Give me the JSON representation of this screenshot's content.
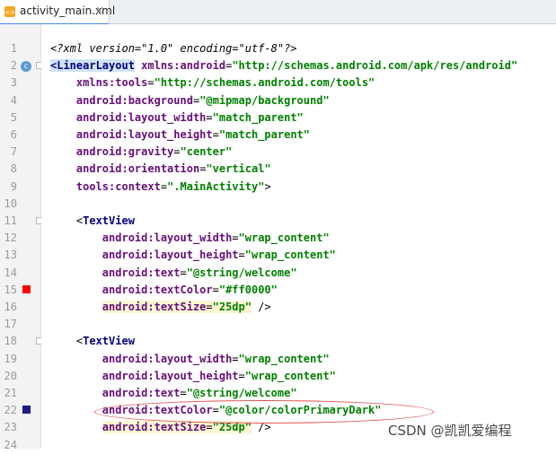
{
  "tab": {
    "filename": "activity_main.xml",
    "close": "×"
  },
  "colors": {
    "red_swatch": "#ff0000",
    "dark_swatch": "#1a1a8c",
    "circle_badge": "#5b9bd5"
  },
  "lines": [
    {
      "num": "1",
      "segs": [
        [
          "decl",
          "<?xml version=\"1.0\" encoding=\"utf-8\"?>"
        ]
      ]
    },
    {
      "num": "2",
      "segs": [
        [
          "hl-tag",
          "<LinearLayout"
        ],
        [
          "plain",
          " "
        ],
        [
          "attr",
          "xmlns:android"
        ],
        [
          "plain",
          "="
        ],
        [
          "val",
          "\"http://schemas.android.com/apk/res/android\""
        ]
      ]
    },
    {
      "num": "3",
      "segs": [
        [
          "plain",
          "    "
        ],
        [
          "attr",
          "xmlns:tools"
        ],
        [
          "plain",
          "="
        ],
        [
          "val",
          "\"http://schemas.android.com/tools\""
        ]
      ]
    },
    {
      "num": "4",
      "segs": [
        [
          "plain",
          "    "
        ],
        [
          "attr",
          "android:background"
        ],
        [
          "plain",
          "="
        ],
        [
          "val",
          "\"@mipmap/background\""
        ]
      ]
    },
    {
      "num": "5",
      "segs": [
        [
          "plain",
          "    "
        ],
        [
          "attr",
          "android:layout_width"
        ],
        [
          "plain",
          "="
        ],
        [
          "val",
          "\"match_parent\""
        ]
      ]
    },
    {
      "num": "6",
      "segs": [
        [
          "plain",
          "    "
        ],
        [
          "attr",
          "android:layout_height"
        ],
        [
          "plain",
          "="
        ],
        [
          "val",
          "\"match_parent\""
        ]
      ]
    },
    {
      "num": "7",
      "segs": [
        [
          "plain",
          "    "
        ],
        [
          "attr",
          "android:gravity"
        ],
        [
          "plain",
          "="
        ],
        [
          "val",
          "\"center\""
        ]
      ]
    },
    {
      "num": "8",
      "segs": [
        [
          "plain",
          "    "
        ],
        [
          "attr",
          "android:orientation"
        ],
        [
          "plain",
          "="
        ],
        [
          "val",
          "\"vertical\""
        ]
      ]
    },
    {
      "num": "9",
      "segs": [
        [
          "plain",
          "    "
        ],
        [
          "attr",
          "tools:context"
        ],
        [
          "plain",
          "="
        ],
        [
          "val",
          "\".MainActivity\""
        ],
        [
          "plain",
          ">"
        ]
      ]
    },
    {
      "num": "10",
      "segs": []
    },
    {
      "num": "11",
      "segs": [
        [
          "plain",
          "    <"
        ],
        [
          "tag",
          "TextView"
        ]
      ]
    },
    {
      "num": "12",
      "segs": [
        [
          "plain",
          "        "
        ],
        [
          "attr",
          "android:layout_width"
        ],
        [
          "plain",
          "="
        ],
        [
          "val",
          "\"wrap_content\""
        ]
      ]
    },
    {
      "num": "13",
      "segs": [
        [
          "plain",
          "        "
        ],
        [
          "attr",
          "android:layout_height"
        ],
        [
          "plain",
          "="
        ],
        [
          "val",
          "\"wrap_content\""
        ]
      ]
    },
    {
      "num": "14",
      "segs": [
        [
          "plain",
          "        "
        ],
        [
          "attr",
          "android:text"
        ],
        [
          "plain",
          "="
        ],
        [
          "val",
          "\"@string/welcome\""
        ]
      ]
    },
    {
      "num": "15",
      "segs": [
        [
          "plain",
          "        "
        ],
        [
          "attr",
          "android:textColor"
        ],
        [
          "plain",
          "="
        ],
        [
          "val",
          "\"#ff0000\""
        ]
      ]
    },
    {
      "num": "16",
      "segs": [
        [
          "plain",
          "        "
        ],
        [
          "attr hl-line",
          "android:textSize"
        ],
        [
          "plain hl-line",
          "="
        ],
        [
          "val hl-line",
          "\"25dp\""
        ],
        [
          "plain",
          " />"
        ]
      ]
    },
    {
      "num": "17",
      "segs": []
    },
    {
      "num": "18",
      "segs": [
        [
          "plain",
          "    <"
        ],
        [
          "tag",
          "TextView"
        ]
      ]
    },
    {
      "num": "19",
      "segs": [
        [
          "plain",
          "        "
        ],
        [
          "attr",
          "android:layout_width"
        ],
        [
          "plain",
          "="
        ],
        [
          "val",
          "\"wrap_content\""
        ]
      ]
    },
    {
      "num": "20",
      "segs": [
        [
          "plain",
          "        "
        ],
        [
          "attr",
          "android:layout_height"
        ],
        [
          "plain",
          "="
        ],
        [
          "val",
          "\"wrap_content\""
        ]
      ]
    },
    {
      "num": "21",
      "segs": [
        [
          "plain",
          "        "
        ],
        [
          "attr",
          "android:text"
        ],
        [
          "plain",
          "="
        ],
        [
          "val",
          "\"@string/welcome\""
        ]
      ]
    },
    {
      "num": "22",
      "segs": [
        [
          "plain",
          "        "
        ],
        [
          "attr",
          "android:textColor"
        ],
        [
          "plain",
          "="
        ],
        [
          "val",
          "\"@color/colorPrimaryDark\""
        ]
      ]
    },
    {
      "num": "23",
      "segs": [
        [
          "plain",
          "        "
        ],
        [
          "attr hl-line",
          "android:textSize"
        ],
        [
          "plain hl-line",
          "="
        ],
        [
          "val hl-line",
          "\"25dp\""
        ],
        [
          "plain",
          " />"
        ]
      ]
    },
    {
      "num": "24",
      "segs": []
    }
  ],
  "watermark": "CSDN @凯凯爱编程"
}
